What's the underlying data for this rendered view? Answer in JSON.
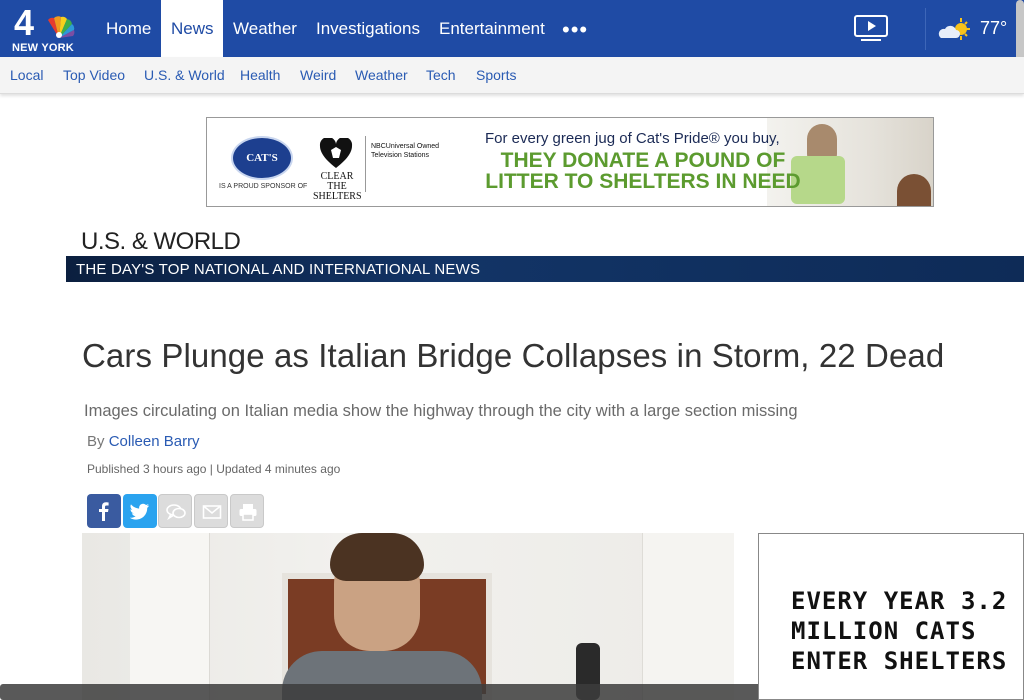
{
  "brand": {
    "logo_number": "4",
    "logo_city": "NEW YORK"
  },
  "nav": {
    "items": [
      {
        "label": "Home"
      },
      {
        "label": "News",
        "active": true
      },
      {
        "label": "Weather"
      },
      {
        "label": "Investigations"
      },
      {
        "label": "Entertainment"
      }
    ],
    "more_label": "•••",
    "temperature": "77°"
  },
  "subnav": {
    "items": [
      {
        "label": "Local"
      },
      {
        "label": "Top Video"
      },
      {
        "label": "U.S. & World"
      },
      {
        "label": "Health"
      },
      {
        "label": "Weird"
      },
      {
        "label": "Weather"
      },
      {
        "label": "Tech"
      },
      {
        "label": "Sports"
      }
    ]
  },
  "ad_banner": {
    "brand": "CAT'S PRIDE",
    "sponsor_text": "IS A PROUD SPONSOR OF",
    "partner": "CLEAR THE SHELTERS",
    "network": "NBCUniversal Owned Television Stations",
    "headline": "For every green jug of Cat's Pride® you buy,",
    "big_line1": "THEY DONATE A POUND OF",
    "big_line2": "LITTER TO SHELTERS IN NEED"
  },
  "section": {
    "title": "U.S. & WORLD",
    "subtitle": "THE DAY'S TOP NATIONAL AND INTERNATIONAL NEWS"
  },
  "article": {
    "headline": "Cars Plunge as Italian Bridge Collapses in Storm, 22 Dead",
    "dek": "Images circulating on Italian media show the highway through the city with a large section missing",
    "by_label": "By",
    "author": "Colleen Barry",
    "published": "Published 3 hours ago | Updated 4 minutes ago"
  },
  "share": [
    "facebook-icon",
    "twitter-icon",
    "comment-icon",
    "email-icon",
    "print-icon"
  ],
  "side_ad": {
    "text": "EVERY YEAR 3.2\nMILLION CATS\nENTER SHELTERS"
  },
  "colors": {
    "nav_blue": "#1f4ba5",
    "link_blue": "#2a5bb3",
    "section_bar": "#123466",
    "facebook": "#3a5ba0",
    "twitter": "#2aa3ef"
  }
}
